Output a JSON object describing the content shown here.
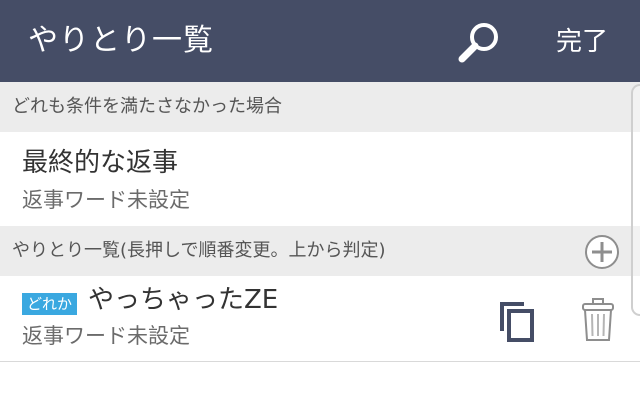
{
  "header": {
    "title": "やりとり一覧",
    "done_label": "完了",
    "search_icon": "search-icon",
    "background_color": "#454d66"
  },
  "section_default": {
    "label": "どれも条件を満たさなかった場合"
  },
  "default_reply": {
    "title": "最終的な返事",
    "subtitle": "返事ワード未設定"
  },
  "section_list": {
    "label": "やりとり一覧(長押しで順番変更。上から判定)",
    "add_icon": "plus-circle-icon"
  },
  "items": [
    {
      "badge": "どれか",
      "title": "やっちゃったZE",
      "subtitle": "返事ワード未設定",
      "copy_icon": "copy-icon",
      "delete_icon": "trash-icon"
    }
  ],
  "colors": {
    "badge": "#3aa8e0",
    "section_background": "#ececec"
  }
}
